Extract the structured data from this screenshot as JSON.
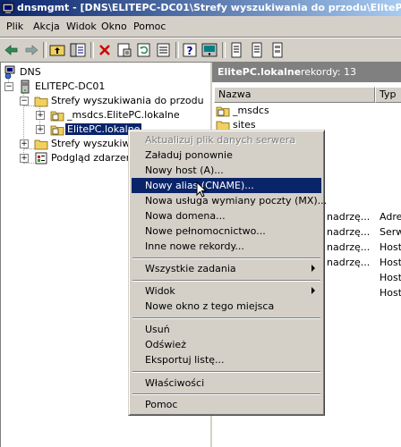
{
  "window": {
    "title": "dnsmgmt - [DNS\\ELITEPC-DC01\\Strefy wyszukiwania do przodu\\ElitePC.lokaln"
  },
  "menu": [
    "Plik",
    "Akcja",
    "Widok",
    "Okno",
    "Pomoc"
  ],
  "toolbar": {
    "icons": [
      "back-arrow-icon",
      "forward-arrow-icon",
      "up-folder-icon",
      "show-hide-tree-icon",
      "delete-icon",
      "properties-icon",
      "refresh-icon",
      "export-list-icon",
      "help-icon",
      "console-icon",
      "new-record-icon",
      "new-record-alt-icon",
      "update-server-data-icon"
    ]
  },
  "tree": {
    "items": [
      {
        "label": "DNS",
        "icon": "dns-icon"
      },
      {
        "label": "ELITEPC-DC01",
        "icon": "server-icon"
      },
      {
        "label": "Strefy wyszukiwania do przodu",
        "icon": "folder-icon"
      },
      {
        "label": "_msdcs.ElitePC.lokalne",
        "icon": "zone-icon"
      },
      {
        "label": "ElitePC.lokalne",
        "icon": "zone-icon",
        "selected": true
      },
      {
        "label": "Strefy wyszukiwa",
        "icon": "folder-icon"
      },
      {
        "label": "Podgląd zdarzeń",
        "icon": "event-viewer-icon"
      }
    ]
  },
  "right_pane": {
    "zone_title": "ElitePC.lokalne",
    "record_count": "rekordy: 13",
    "columns": [
      "Nazwa",
      "Typ"
    ],
    "rows": [
      {
        "name": "_msdcs",
        "type": ""
      },
      {
        "name": "sites",
        "type": ""
      },
      {
        "name": "nadrzę...",
        "type": "Adres"
      },
      {
        "name": "nadrzę...",
        "type": "Serw"
      },
      {
        "name": "nadrzę...",
        "type": "Host"
      },
      {
        "name": "nadrzę...",
        "type": "Host"
      },
      {
        "name": "",
        "type": "Host"
      },
      {
        "name": "",
        "type": "Host"
      }
    ]
  },
  "context_menu": {
    "items": [
      {
        "label": "Aktualizuj plik danych serwera",
        "disabled": true
      },
      {
        "label": "Załaduj ponownie"
      },
      {
        "label": "Nowy host (A)..."
      },
      {
        "label": "Nowy alias (CNAME)...",
        "highlighted": true
      },
      {
        "label": "Nowa usługa wymiany poczty (MX)..."
      },
      {
        "label": "Nowa domena..."
      },
      {
        "label": "Nowe pełnomocnictwo..."
      },
      {
        "label": "Inne nowe rekordy..."
      },
      {
        "label": "Wszystkie zadania",
        "submenu": true
      },
      {
        "label": "Widok",
        "submenu": true
      },
      {
        "label": "Nowe okno z tego miejsca"
      },
      {
        "label": "Usuń"
      },
      {
        "label": "Odśwież"
      },
      {
        "label": "Eksportuj listę..."
      },
      {
        "label": "Właściwości"
      },
      {
        "label": "Pomoc"
      }
    ]
  },
  "colors": {
    "selection": "#0a246a",
    "title_gradient_start": "#0a246a",
    "title_gradient_end": "#a6caf0",
    "face": "#d4d0c8"
  }
}
